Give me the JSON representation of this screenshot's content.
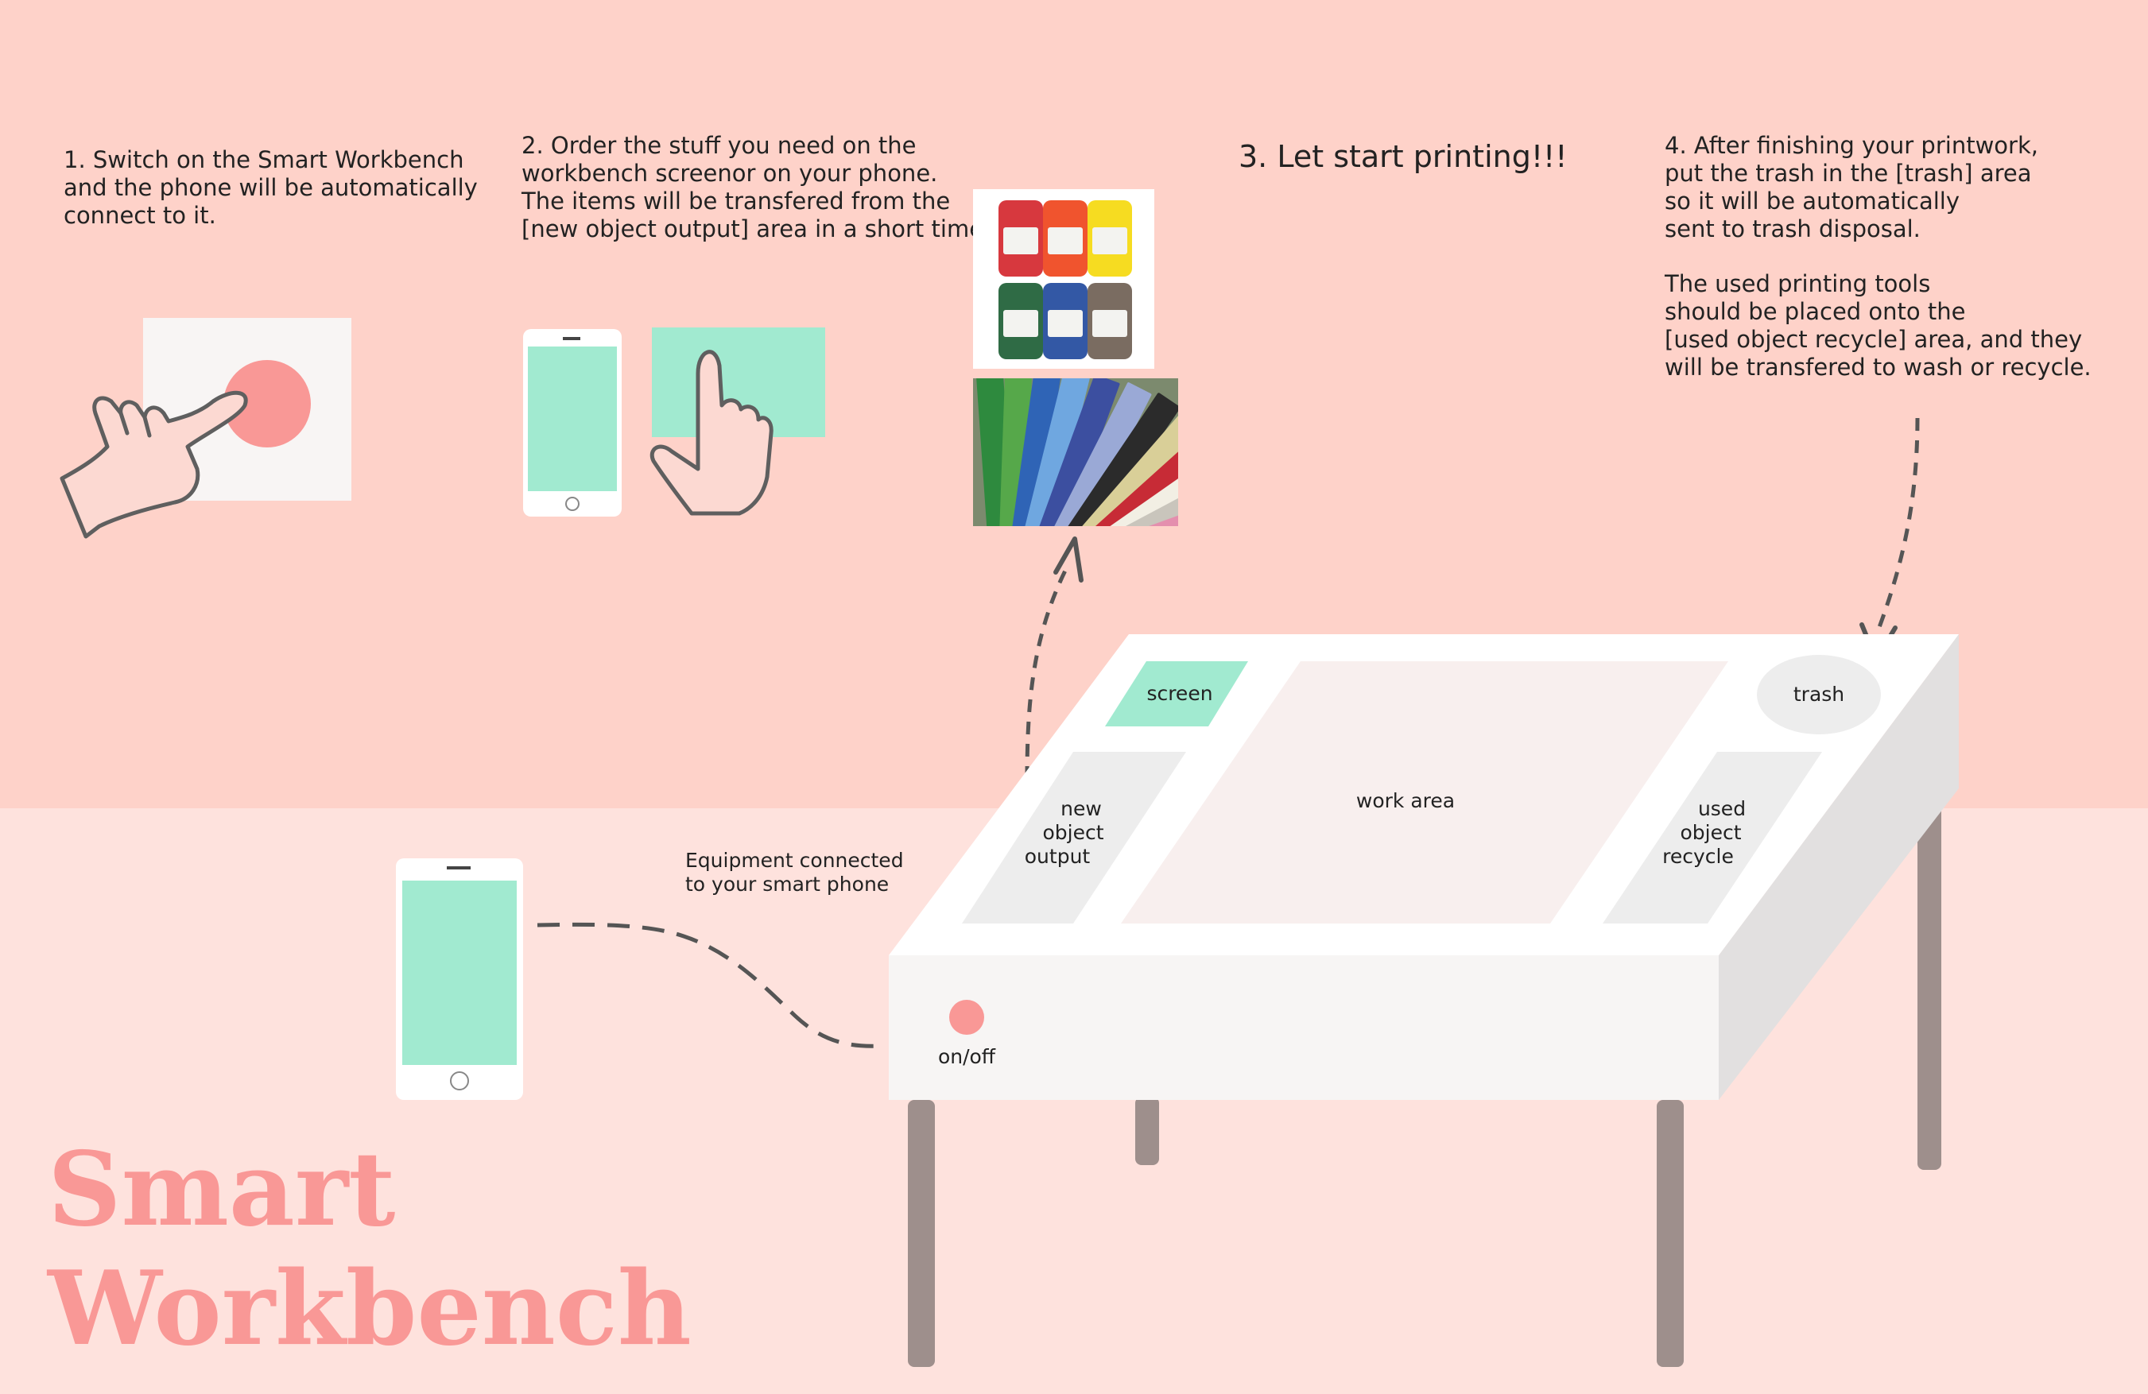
{
  "steps": {
    "step1": {
      "lines": [
        "1. Switch on the Smart Workbench",
        "and the phone will be automatically",
        "connect to it."
      ]
    },
    "step2": {
      "lines": [
        "2. Order the stuff you need on the",
        "workbench screenor on your phone.",
        "The items will be transfered from the",
        "[new object output] area in a short time."
      ]
    },
    "step3": {
      "lines": [
        "3. Let start printing!!!"
      ]
    },
    "step4": {
      "lines": [
        "4. After finishing your printwork,",
        "put the trash in the [trash] area",
        "so it will be automatically",
        "sent to trash disposal."
      ],
      "tools_lines": [
        "The used printing tools",
        "should be placed onto the",
        "[used object recycle] area, and they",
        "will be transfered to wash or recycle."
      ]
    }
  },
  "equipment_caption": {
    "lines": [
      "Equipment connected",
      "to your smart phone"
    ]
  },
  "workbench": {
    "screen_label": "screen",
    "work_area_label": "work area",
    "trash_label": "trash",
    "new_object_output_lines": [
      "new",
      "object",
      "output"
    ],
    "used_object_recycle_lines": [
      "used",
      "object",
      "recycle"
    ],
    "power_label": "on/off"
  },
  "brand": {
    "line1": "Smart",
    "line2": "Workbench"
  },
  "icons": {
    "power_button": "power-button-icon",
    "hand_press": "hand-pointer-icon",
    "phone": "smartphone-icon",
    "touch_screen": "touch-screen-icon",
    "paint_bottles": "paint-bottles-photo",
    "paper_samples": "paper-samples-photo",
    "arrows": "dashed-arrow-icon"
  },
  "colors": {
    "background_top": "#fed2c9",
    "background_bottom": "#fee2dd",
    "accent_red": "#f99896",
    "mint": "#a1ead0",
    "bench_top": "#ffffff",
    "bench_side": "#e4e2e2",
    "leg": "#9e8f8c",
    "dash_line": "#555555"
  }
}
